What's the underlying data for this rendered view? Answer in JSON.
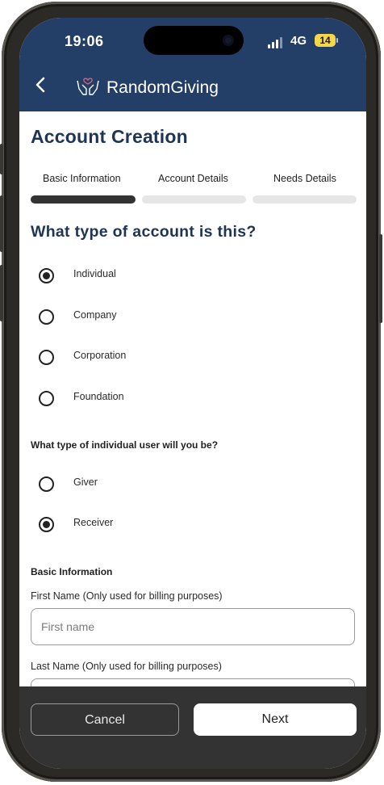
{
  "status": {
    "time": "19:06",
    "network": "4G",
    "battery": "14"
  },
  "header": {
    "app_name": "RandomGiving",
    "back_icon": "chevron-left-icon",
    "logo_icon": "hands-heart-icon"
  },
  "page": {
    "title": "Account Creation"
  },
  "steps": [
    {
      "label": "Basic Information",
      "active": true
    },
    {
      "label": "Account Details",
      "active": false
    },
    {
      "label": "Needs Details",
      "active": false
    }
  ],
  "account_type": {
    "question": "What type of account is this?",
    "options": [
      {
        "label": "Individual",
        "selected": true
      },
      {
        "label": "Company",
        "selected": false
      },
      {
        "label": "Corporation",
        "selected": false
      },
      {
        "label": "Foundation",
        "selected": false
      }
    ]
  },
  "user_type": {
    "question": "What type of individual user will you be?",
    "options": [
      {
        "label": "Giver",
        "selected": false
      },
      {
        "label": "Receiver",
        "selected": true
      }
    ]
  },
  "basic_info": {
    "heading": "Basic Information",
    "first_name": {
      "label": "First Name (Only used for billing purposes)",
      "placeholder": "First name",
      "value": ""
    },
    "last_name": {
      "label": "Last Name (Only used for billing purposes)",
      "placeholder": "",
      "value": ""
    }
  },
  "footer": {
    "cancel_label": "Cancel",
    "next_label": "Next"
  },
  "colors": {
    "header_bg": "#243f67",
    "title": "#1e3556",
    "step_active": "#333333",
    "step_inactive": "#e6e6e6",
    "footer_bg": "#333333"
  }
}
